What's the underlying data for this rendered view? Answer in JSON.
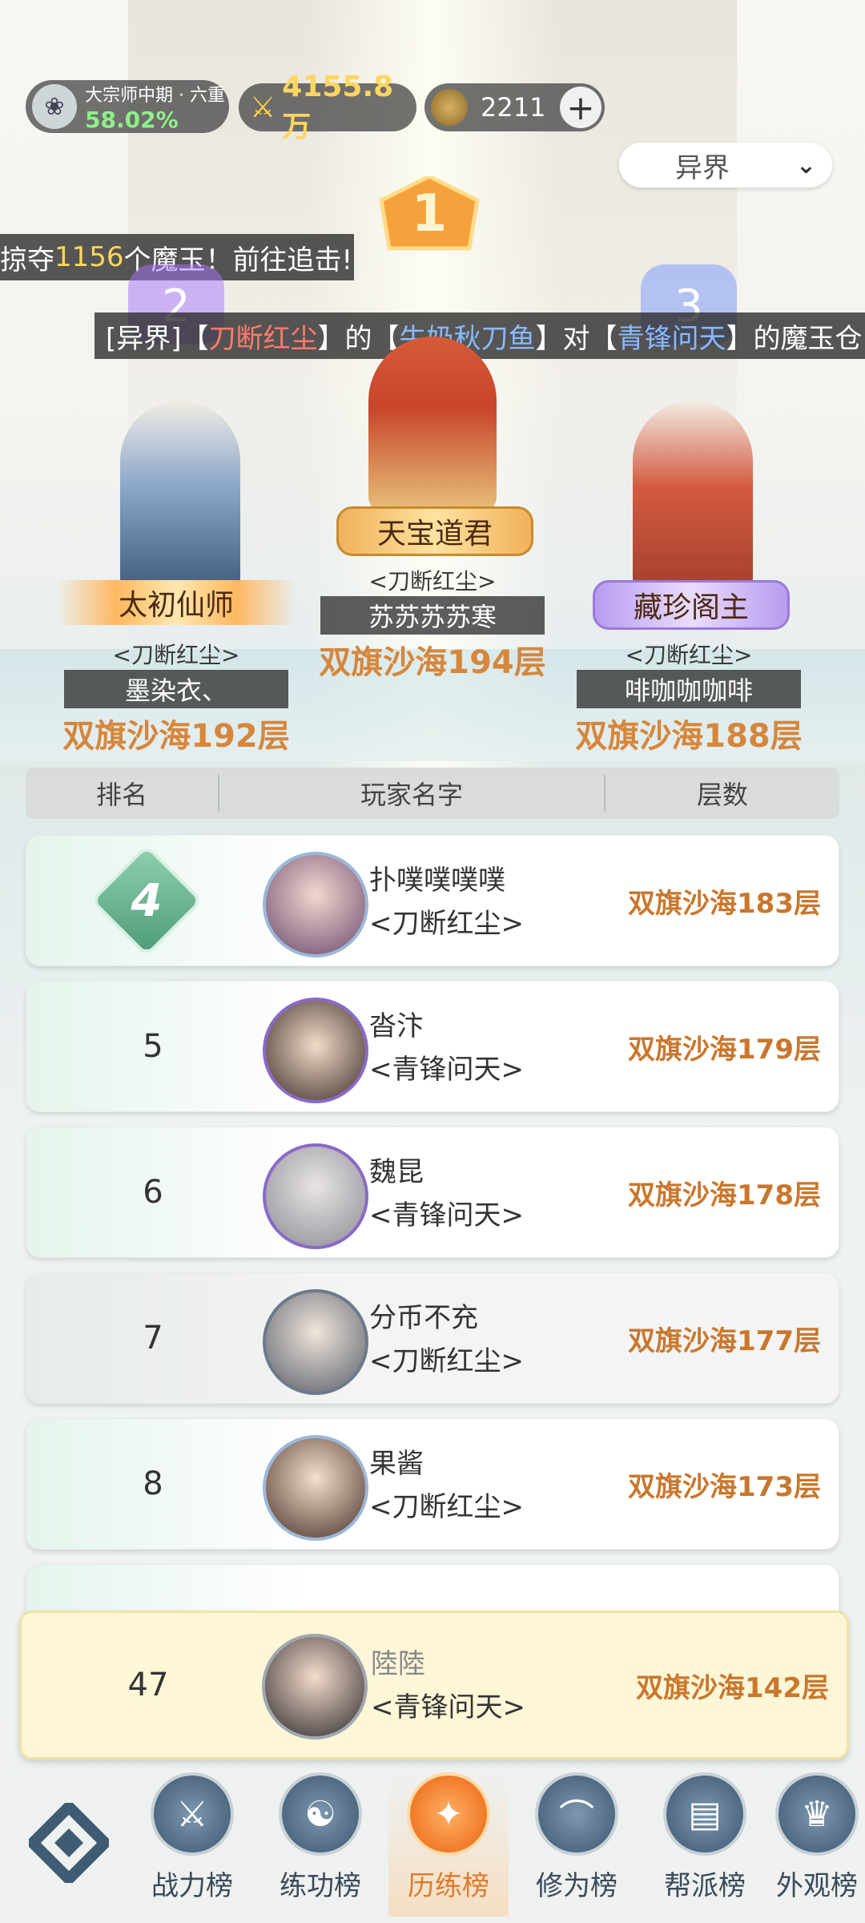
{
  "header": {
    "rank_title": "大宗师中期 · 六重",
    "rank_percent": "58.02%",
    "power": "4155.8万",
    "currency": "2211",
    "realm_select": "异界"
  },
  "announcements": {
    "line1_prefix": "掠夺",
    "line1_count": "1156",
    "line1_suffix": "个魔玉！前往追击!",
    "line2_a": "[异界]【",
    "line2_guild1": "刀断红尘",
    "line2_b": "】的【",
    "line2_player": "牛奶秋刀鱼",
    "line2_c": "】对【",
    "line2_guild2": "青锋问天",
    "line2_d": "】的魔玉仓"
  },
  "podium": {
    "first": {
      "rank": "1",
      "title": "天宝道君",
      "guild": "<刀断红尘>",
      "name": "苏苏苏苏寒",
      "floor": "双旗沙海194层"
    },
    "second": {
      "rank": "2",
      "title": "太初仙师",
      "guild": "<刀断红尘>",
      "name": "墨染衣、",
      "floor": "双旗沙海192层"
    },
    "third": {
      "rank": "3",
      "title": "藏珍阁主",
      "guild": "<刀断红尘>",
      "name": "啡咖咖咖啡",
      "floor": "双旗沙海188层"
    }
  },
  "table": {
    "col_rank": "排名",
    "col_name": "玩家名字",
    "col_floor": "层数",
    "rows": [
      {
        "rank": "4",
        "name": "扑噗噗噗噗",
        "guild": "<刀断红尘>",
        "floor": "双旗沙海183层"
      },
      {
        "rank": "5",
        "name": "沓汴",
        "guild": "<青锋问天>",
        "floor": "双旗沙海179层"
      },
      {
        "rank": "6",
        "name": "魏昆",
        "guild": "<青锋问天>",
        "floor": "双旗沙海178层"
      },
      {
        "rank": "7",
        "name": "分币不充",
        "guild": "<刀断红尘>",
        "floor": "双旗沙海177层"
      },
      {
        "rank": "8",
        "name": "果酱",
        "guild": "<刀断红尘>",
        "floor": "双旗沙海173层"
      }
    ]
  },
  "my_rank": {
    "rank": "47",
    "name": "陸陸",
    "guild": "<青锋问天>",
    "floor": "双旗沙海142层"
  },
  "nav": {
    "items": [
      "战力榜",
      "练功榜",
      "历练榜",
      "修为榜",
      "帮派榜",
      "外观榜"
    ],
    "active": "历练榜"
  },
  "colors": {
    "accent": "#e07a2a",
    "floor_text": "#c9772e",
    "rank4_badge": "#5fae8c"
  }
}
